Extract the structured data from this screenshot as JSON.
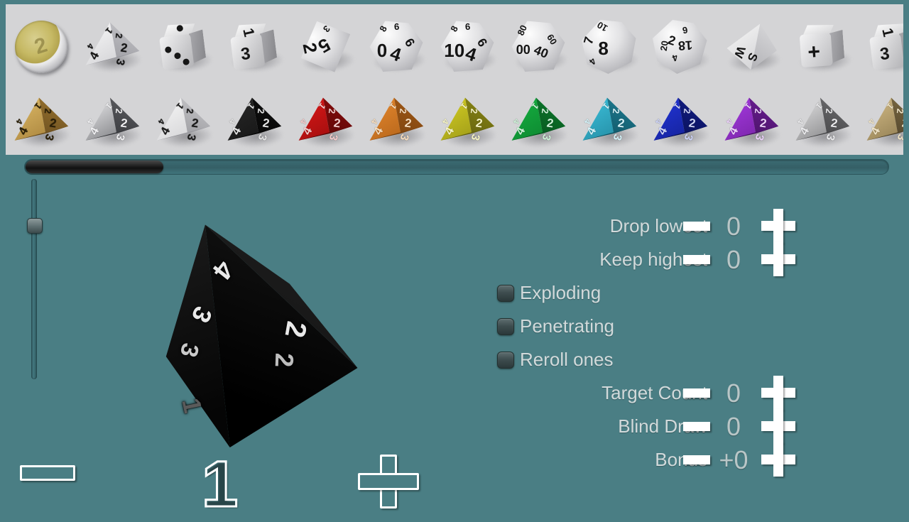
{
  "app": {
    "background_color": "#4a7e84",
    "tray_background_color": "#d4d4d6"
  },
  "tray": {
    "name": "dice-tray",
    "row_top": [
      {
        "id": "coin",
        "label": "2",
        "kind": "coin"
      },
      {
        "id": "d4",
        "label": "d4",
        "kind": "tetra",
        "faces": [
          "1",
          "2",
          "2",
          "3",
          "4",
          "4"
        ]
      },
      {
        "id": "d6-pips",
        "label": "d6",
        "kind": "cube-pips",
        "top_pips": 1,
        "front_pips": 3
      },
      {
        "id": "d6",
        "label": "d6",
        "kind": "cube",
        "top": "1",
        "front": "3"
      },
      {
        "id": "d8",
        "label": "d8",
        "kind": "poly",
        "values": [
          "2",
          "5",
          "3"
        ]
      },
      {
        "id": "d10",
        "label": "d10",
        "kind": "poly",
        "values": [
          "0",
          "4",
          "6",
          "8"
        ]
      },
      {
        "id": "d10x",
        "label": "d10",
        "kind": "poly",
        "values": [
          "10",
          "4",
          "6",
          "8"
        ]
      },
      {
        "id": "d100",
        "label": "d100",
        "kind": "poly",
        "values": [
          "00",
          "40",
          "60",
          "80"
        ]
      },
      {
        "id": "d12",
        "label": "d12",
        "kind": "poly",
        "values": [
          "8",
          "7",
          "4",
          "10"
        ]
      },
      {
        "id": "d20",
        "label": "d20",
        "kind": "poly",
        "values": [
          "2",
          "18",
          "20",
          "4",
          "9"
        ]
      },
      {
        "id": "d4-direction",
        "label": "direction",
        "kind": "pyramid",
        "values": [
          "W",
          "S"
        ]
      },
      {
        "id": "d6-fudge",
        "label": "fudge",
        "kind": "cube-plus",
        "face": "+"
      },
      {
        "id": "d6-end",
        "label": "d6",
        "kind": "cube",
        "top": "1",
        "front": "3"
      }
    ],
    "row_bottom": [
      {
        "id": "d4-gold",
        "label": "gold",
        "c_light": "#e0bd6a",
        "c_mid": "#9a7430",
        "c_dark": "#5d441a",
        "c_mid2": "#7d5c24",
        "c_num": "#2b2008"
      },
      {
        "id": "d4-chrome",
        "label": "chrome",
        "c_light": "#f2f2f4",
        "c_mid": "#5f6064",
        "c_dark": "#2b2c30",
        "c_mid2": "#46474b",
        "c_num": "#f0f0f2"
      },
      {
        "id": "d4-white",
        "label": "white",
        "c_light": "#fafafa",
        "c_mid": "#c9c9cc",
        "c_dark": "#8b8b90",
        "c_mid2": "#a9a9ae",
        "c_num": "#1a1a1a"
      },
      {
        "id": "d4-black",
        "label": "black",
        "c_light": "#2a2a2a",
        "c_mid": "#101010",
        "c_dark": "#040404",
        "c_mid2": "#0a0a0a",
        "c_num": "#e4e4e4"
      },
      {
        "id": "d4-red",
        "label": "red",
        "c_light": "#e01818",
        "c_mid": "#8c0b0b",
        "c_dark": "#4a0606",
        "c_mid2": "#6d0808",
        "c_num": "#f2caca"
      },
      {
        "id": "d4-orange",
        "label": "orange",
        "c_light": "#e98a2e",
        "c_mid": "#a65b16",
        "c_dark": "#6b3a0c",
        "c_mid2": "#8a4a11",
        "c_num": "#f7ddbe"
      },
      {
        "id": "d4-yellow",
        "label": "yellow",
        "c_light": "#d8d224",
        "c_mid": "#8d8a15",
        "c_dark": "#55530c",
        "c_mid2": "#6f6d10",
        "c_num": "#f6f4c4"
      },
      {
        "id": "d4-green",
        "label": "green",
        "c_light": "#15b341",
        "c_mid": "#0c7a2c",
        "c_dark": "#064a1a",
        "c_mid2": "#086123",
        "c_num": "#cdf0d7"
      },
      {
        "id": "d4-cyan",
        "label": "cyan",
        "c_light": "#3ec4df",
        "c_mid": "#1d7d93",
        "c_dark": "#0e4c5b",
        "c_mid2": "#156476",
        "c_num": "#d4f1f7"
      },
      {
        "id": "d4-blue",
        "label": "blue",
        "c_light": "#2236dd",
        "c_mid": "#111c86",
        "c_dark": "#080f4c",
        "c_mid2": "#0c1566",
        "c_num": "#ccd2f5"
      },
      {
        "id": "d4-purple",
        "label": "purple",
        "c_light": "#a93ce6",
        "c_mid": "#6c1d96",
        "c_dark": "#3f1058",
        "c_mid2": "#521573",
        "c_num": "#ead0f8"
      },
      {
        "id": "d4-marble",
        "label": "marble",
        "c_light": "#e9e9ea",
        "c_mid": "#6e6e70",
        "c_dark": "#3a3a3c",
        "c_mid2": "#525254",
        "c_num": "#eaeaec"
      },
      {
        "id": "d4-wood",
        "label": "wood",
        "c_light": "#d8c08a",
        "c_mid": "#7e6c44",
        "c_dark": "#433824",
        "c_mid2": "#5e5032",
        "c_num": "#efe3c6"
      }
    ]
  },
  "scrollbar": {
    "name": "tray-scrollbar",
    "thumb_position_pct": 0,
    "thumb_width_pct": 16
  },
  "size_slider": {
    "name": "die-size-slider",
    "orientation": "vertical",
    "handle_position_pct": 21
  },
  "main_die": {
    "type": "d4",
    "color": "black",
    "visible_numbers": [
      "4",
      "3",
      "3",
      "2",
      "2",
      "1"
    ]
  },
  "count_controls": {
    "minus_label": "—",
    "value": "1",
    "plus_label": "+"
  },
  "options": [
    {
      "name": "drop-lowest",
      "label": "Drop lowest",
      "kind": "stepper",
      "value": "0"
    },
    {
      "name": "keep-highest",
      "label": "Keep highest",
      "kind": "stepper",
      "value": "0"
    },
    {
      "name": "exploding",
      "label": "Exploding",
      "kind": "toggle",
      "value": "off"
    },
    {
      "name": "penetrating",
      "label": "Penetrating",
      "kind": "toggle",
      "value": "off"
    },
    {
      "name": "reroll-ones",
      "label": "Reroll ones",
      "kind": "toggle",
      "value": "off"
    },
    {
      "name": "target-count",
      "label": "Target Count",
      "kind": "stepper",
      "value": "0"
    },
    {
      "name": "blind-draw",
      "label": "Blind Draw",
      "kind": "stepper",
      "value": "0"
    },
    {
      "name": "bonus",
      "label": "Bonus",
      "kind": "stepper",
      "value": "+0"
    }
  ]
}
